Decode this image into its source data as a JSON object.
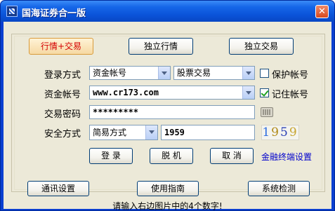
{
  "window": {
    "title": "国海证券合一版",
    "close_symbol": "✕"
  },
  "mode_tabs": [
    "行情+交易",
    "独立行情",
    "独立交易"
  ],
  "form": {
    "login_mode": {
      "label": "登录方式",
      "value": "资金帐号",
      "market_value": "股票交易",
      "protect_label": "保护帐号",
      "protect_checked": false
    },
    "account": {
      "label": "资金帐号",
      "value": "www.cr173.com",
      "remember_label": "记住帐号",
      "remember_checked": true
    },
    "password": {
      "label": "交易密码",
      "value": "*********"
    },
    "security": {
      "label": "安全方式",
      "mode_value": "简易方式",
      "code_value": "1959",
      "captcha": [
        "1",
        "9",
        "5",
        "9"
      ]
    }
  },
  "actions": {
    "login": "登 录",
    "offline": "脱 机",
    "cancel": "取 消",
    "terminal_settings": "金融终端设置"
  },
  "bottom_buttons": {
    "comm_settings": "通讯设置",
    "guide": "使用指南",
    "system_check": "系统检测"
  },
  "status_text": "请输入右边图片中的4个数字!"
}
